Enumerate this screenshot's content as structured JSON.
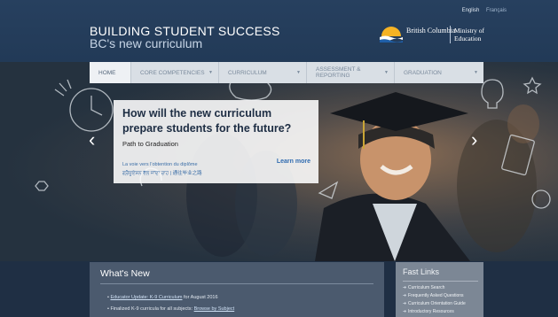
{
  "header": {
    "lang_english": "English",
    "lang_french": "Français",
    "title": "BUILDING STUDENT SUCCESS",
    "subtitle": "BC's new curriculum",
    "logo_bc": "British Columbia",
    "logo_ministry": "Ministry of Education"
  },
  "nav": {
    "items": [
      {
        "label": "HOME"
      },
      {
        "label": "CORE COMPETENCIES"
      },
      {
        "label": "CURRICULUM"
      },
      {
        "label": "ASSESSMENT & REPORTING"
      },
      {
        "label": "GRADUATION"
      }
    ]
  },
  "slide": {
    "heading": "How will the new curriculum prepare students for the future?",
    "subheading": "Path to Graduation",
    "link_french": "La voie vers l'obtention du diplôme",
    "link_punjabi": "ਗ੍ਰੈਜੂਏਸ਼ਨ ਵੱਲ ਜਾਂਦਾ ਰਾਹ",
    "link_chinese": "通往毕业之路",
    "learn_more": "Learn more",
    "prev_glyph": "‹",
    "next_glyph": "›"
  },
  "whats_new": {
    "heading": "What's New",
    "items": [
      {
        "link": "Educator Update: K-9 Curriculum",
        "text": " for August 2016"
      },
      {
        "text": "Finalized K-9 curricula for all subjects: ",
        "link": "Browse by Subject"
      }
    ]
  },
  "fast_links": {
    "heading": "Fast Links",
    "items": [
      {
        "label": "Curriculum Search"
      },
      {
        "label": "Frequently Asked Questions"
      },
      {
        "label": "Curriculum Orientation Guide"
      },
      {
        "label": "Introductory Resources"
      }
    ]
  },
  "colors": {
    "header_bg": "#223a57",
    "accent_link": "#2f6bb0",
    "nav_bg": "#d9dfe5"
  }
}
